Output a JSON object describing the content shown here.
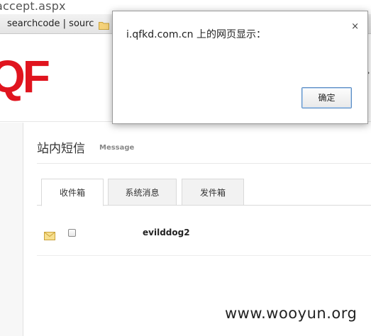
{
  "browser": {
    "url_fragment": "accept.aspx",
    "bookmark_label": "searchcode | sourc",
    "bookmark_folder_icon": "folder-icon"
  },
  "header": {
    "logo_text": "QF",
    "logo_color": "#e0141e"
  },
  "main": {
    "title": "站内短信",
    "subtitle": "Message",
    "tabs": [
      {
        "label": "收件箱",
        "active": true
      },
      {
        "label": "系统消息",
        "active": false
      },
      {
        "label": "发件箱",
        "active": false
      }
    ],
    "messages": [
      {
        "icon": "envelope-icon",
        "sender": "evilddog2"
      }
    ]
  },
  "dialog": {
    "title": "i.qfkd.com.cn 上的网页显示：",
    "close_label": "×",
    "ok_label": "确定"
  },
  "watermark": "www.wooyun.org"
}
